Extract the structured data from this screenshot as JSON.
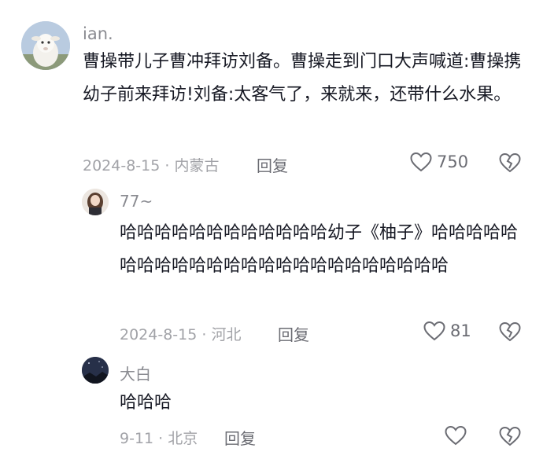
{
  "comments": [
    {
      "username": "ian.",
      "text": "曹操带儿子曹冲拜访刘备。曹操走到门口大声喊道:曹操携幼子前来拜访!刘备:太客气了，来就来，还带什么水果。",
      "date": "2024-8-15",
      "location": "内蒙古",
      "reply_label": "回复",
      "likes": "750",
      "avatar": "goat-avatar"
    },
    {
      "username": "77~",
      "text": "哈哈哈哈哈哈哈哈哈哈哈哈幼子《柚子》哈哈哈哈哈哈哈哈哈哈哈哈哈哈哈哈哈哈哈哈哈哈哈哈",
      "date": "2024-8-15",
      "location": "河北",
      "reply_label": "回复",
      "likes": "81",
      "avatar": "girl-avatar"
    },
    {
      "username": "大白",
      "text": "哈哈哈",
      "date": "9-11",
      "location": "北京",
      "reply_label": "回复",
      "likes": "",
      "avatar": "night-sky-avatar"
    }
  ],
  "colors": {
    "text": "#161823",
    "meta": "#a1a2a7",
    "username": "#8a8b91"
  },
  "icons": [
    "heart-outline-icon",
    "broken-heart-icon"
  ]
}
